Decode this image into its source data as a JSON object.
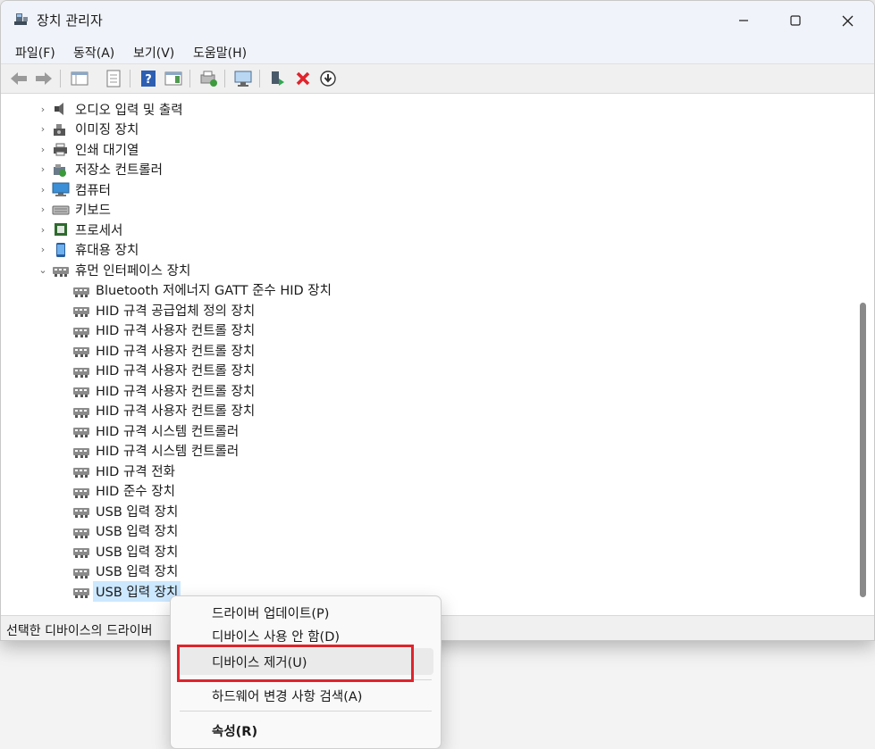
{
  "window": {
    "title": "장치 관리자"
  },
  "menubar": {
    "items": [
      "파일(F)",
      "동작(A)",
      "보기(V)",
      "도움말(H)"
    ]
  },
  "toolbar": {
    "icons": [
      "back-arrow-icon",
      "forward-arrow-icon",
      "properties-grid-icon",
      "document-icon",
      "help-icon",
      "panel-icon",
      "refresh-icon",
      "monitor-scan-icon",
      "enable-device-icon",
      "uninstall-x-icon",
      "download-driver-icon"
    ]
  },
  "tree": {
    "categories": [
      {
        "label": "오디오 입력 및 출력",
        "icon": "speaker-icon"
      },
      {
        "label": "이미징 장치",
        "icon": "camera-icon"
      },
      {
        "label": "인쇄 대기열",
        "icon": "printer-icon"
      },
      {
        "label": "저장소 컨트롤러",
        "icon": "storage-controller-icon"
      },
      {
        "label": "컴퓨터",
        "icon": "computer-icon"
      },
      {
        "label": "키보드",
        "icon": "keyboard-icon"
      },
      {
        "label": "프로세서",
        "icon": "processor-icon"
      },
      {
        "label": "휴대용 장치",
        "icon": "portable-device-icon"
      },
      {
        "label": "휴먼 인터페이스 장치",
        "icon": "hid-icon",
        "expanded": true
      }
    ],
    "hid_children": [
      "Bluetooth 저에너지 GATT 준수 HID 장치",
      "HID 규격 공급업체 정의 장치",
      "HID 규격 사용자 컨트롤 장치",
      "HID 규격 사용자 컨트롤 장치",
      "HID 규격 사용자 컨트롤 장치",
      "HID 규격 사용자 컨트롤 장치",
      "HID 규격 사용자 컨트롤 장치",
      "HID 규격 시스템 컨트롤러",
      "HID 규격 시스템 컨트롤러",
      "HID 규격 전화",
      "HID 준수 장치",
      "USB 입력 장치",
      "USB 입력 장치",
      "USB 입력 장치",
      "USB 입력 장치",
      "USB 입력 장치"
    ]
  },
  "status": {
    "text": "선택한 디바이스의 드라이버"
  },
  "context_menu": {
    "items": [
      "드라이버 업데이트(P)",
      "디바이스 사용 안 함(D)",
      "디바이스 제거(U)",
      "하드웨어 변경 사항 검색(A)",
      "속성(R)"
    ]
  },
  "colors": {
    "highlight_box": "#e0232b",
    "selection": "#cce8ff",
    "scroll_thumb": "#8a8a8a"
  }
}
